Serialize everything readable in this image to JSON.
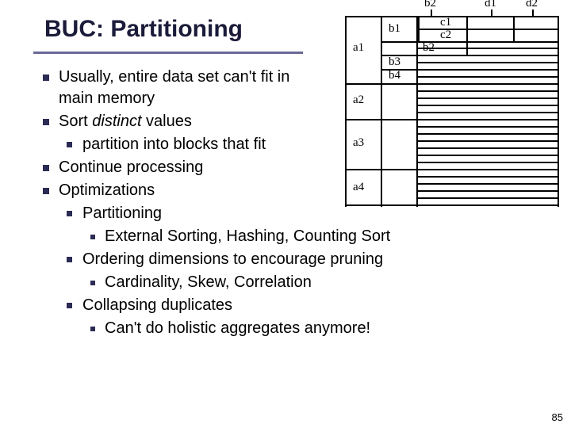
{
  "title": "BUC: Partitioning",
  "bullets": {
    "b1": "Usually, entire data set can't fit in main memory",
    "b2a": "Sort ",
    "b2b": "distinct",
    "b2c": " values",
    "b2_1": "partition into blocks that fit",
    "b3": "Continue processing",
    "b4": "Optimizations",
    "b4_1": "Partitioning",
    "b4_1_1": "External Sorting, Hashing, Counting Sort",
    "b4_2": "Ordering dimensions to encourage pruning",
    "b4_2_1": "Cardinality, Skew, Correlation",
    "b4_3": "Collapsing duplicates",
    "b4_3_1": "Can't do holistic aggregates anymore!"
  },
  "diagram": {
    "top": {
      "b2": "b2",
      "d1": "d1",
      "d2": "d2"
    },
    "a": [
      "a1",
      "a2",
      "a3",
      "a4"
    ],
    "b": [
      "b1",
      "b2",
      "b3",
      "b4"
    ],
    "c": [
      "c1",
      "c2"
    ]
  },
  "page": "85"
}
